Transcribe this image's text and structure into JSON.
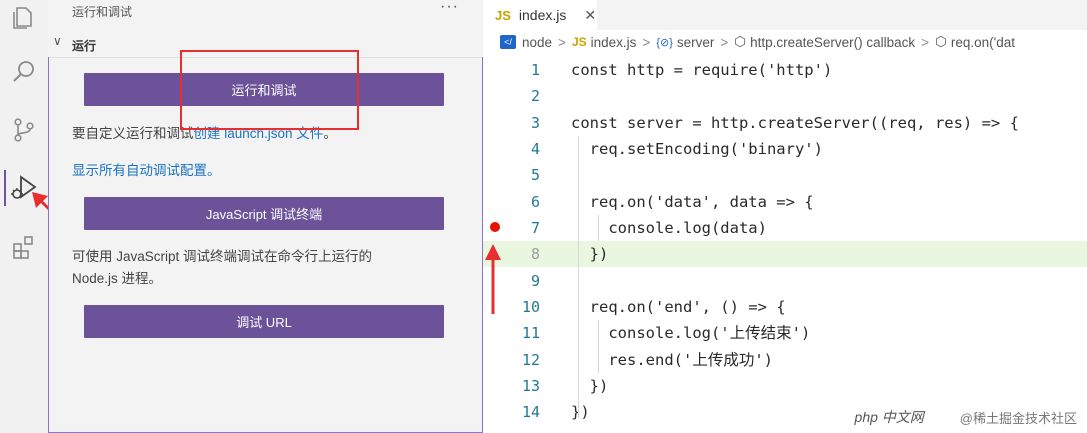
{
  "activity_bar": {
    "icons": [
      "explorer-icon",
      "search-icon",
      "source-control-icon",
      "run-debug-icon",
      "extensions-icon"
    ]
  },
  "sidebar": {
    "title": "运行和调试",
    "more": "···",
    "section": {
      "chevron": "∨",
      "label": "运行"
    },
    "run_debug_button": "运行和调试",
    "launch_text_prefix": "要自定义运行和调试",
    "launch_link": "创建 launch.json 文件",
    "launch_text_suffix": "。",
    "show_all_link": "显示所有自动调试配置。",
    "js_terminal_button": "JavaScript 调试终端",
    "js_terminal_desc_1": "可使用 JavaScript 调试终端调试在命令行上运行的",
    "js_terminal_desc_2": "Node.js 进程。",
    "debug_url_button": "调试 URL"
  },
  "tab": {
    "badge": "JS",
    "name": "index.js",
    "close": "✕"
  },
  "breadcrumb": {
    "items": [
      "node",
      "index.js",
      "server",
      "http.createServer() callback",
      "req.on('dat"
    ],
    "sep": ">",
    "js_badge": "JS",
    "ref_icon": "{⊘}",
    "cube_icon": "⬡"
  },
  "editor": {
    "line_numbers": [
      "1",
      "2",
      "3",
      "4",
      "5",
      "6",
      "7",
      "8",
      "9",
      "10",
      "11",
      "12",
      "13",
      "14"
    ],
    "lines": [
      "const http = require('http')",
      "",
      "const server = http.createServer((req, res) => {",
      "  req.setEncoding('binary')",
      "",
      "  req.on('data', data => {",
      "    console.log(data)",
      "  })",
      "",
      "  req.on('end', () => {",
      "    console.log('上传结束')",
      "    res.end('上传成功')",
      "  })",
      "})"
    ],
    "breakpoint_line": 7,
    "highlighted_line": 8
  },
  "watermark": {
    "logo": "php",
    "site": "中文网",
    "text": "@稀土掘金技术社区"
  },
  "colors": {
    "accent": "#6b5299",
    "annotation": "#e82f2f",
    "link": "#1a73c4"
  }
}
